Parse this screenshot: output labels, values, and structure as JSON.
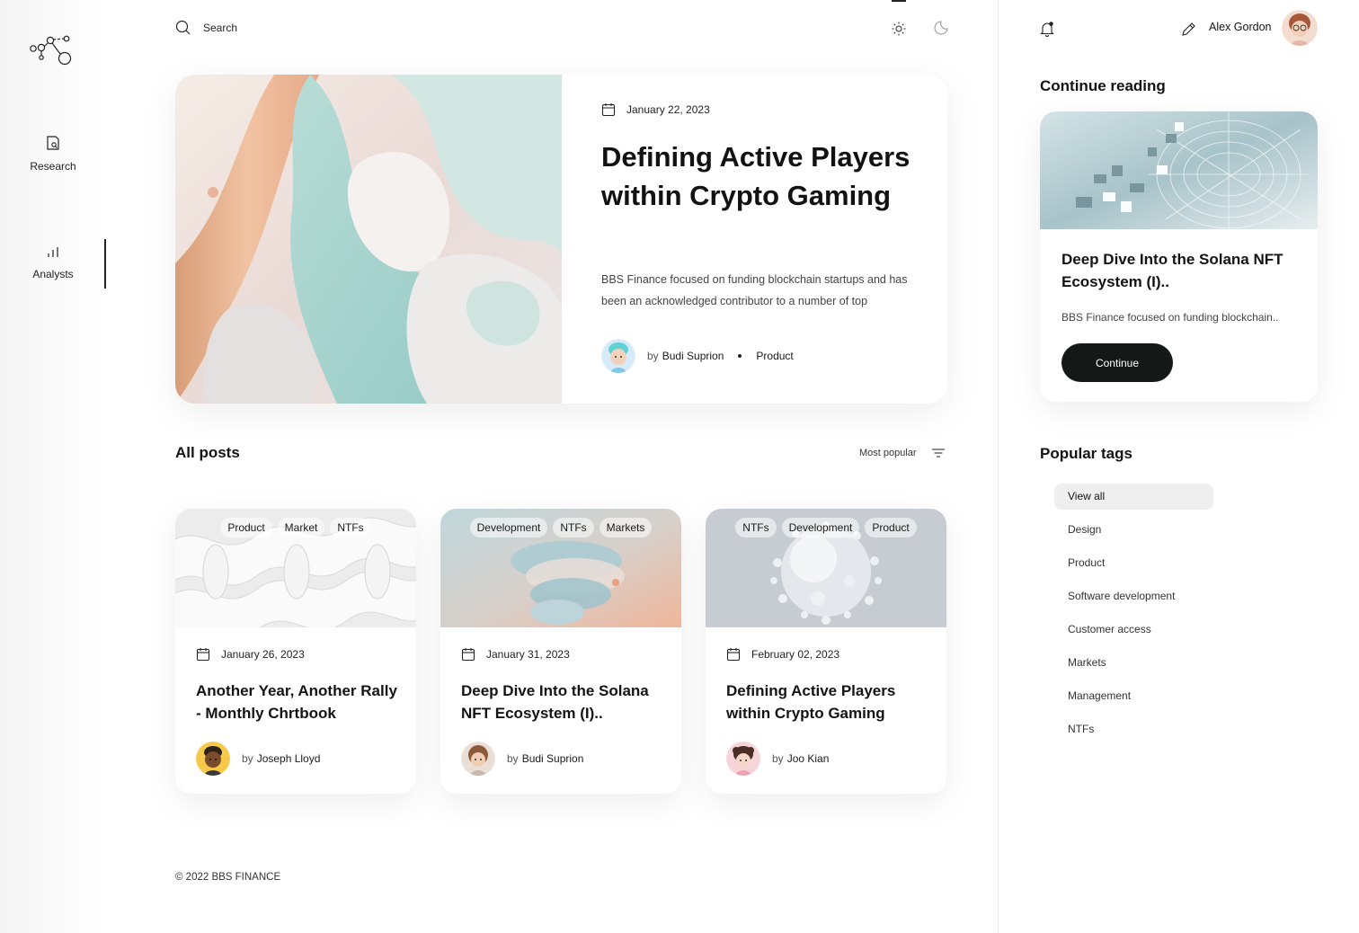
{
  "sidebar": {
    "items": [
      {
        "label": "Research",
        "icon": "search-document-icon"
      },
      {
        "label": "Analysts",
        "icon": "bar-chart-icon"
      }
    ],
    "active": "Analysts"
  },
  "header": {
    "search_placeholder": "Search"
  },
  "hero": {
    "date": "January 22, 2023",
    "title": "Defining Active Players within Crypto Gaming",
    "description": "BBS Finance focused on funding blockchain startups and has been an acknowledged contributor to a number of top",
    "author_prefix": "by",
    "author": "Budi Suprion",
    "category": "Product"
  },
  "posts": {
    "title": "All posts",
    "sort_label": "Most popular",
    "items": [
      {
        "tags": [
          "Product",
          "Market",
          "NTFs"
        ],
        "date": "January 26, 2023",
        "title": "Another Year, Another Rally - Monthly Chrtbook",
        "author_prefix": "by",
        "author": "Joseph Lloyd"
      },
      {
        "tags": [
          "Development",
          "NTFs",
          "Markets"
        ],
        "date": "January 31, 2023",
        "title": "Deep Dive Into the Solana NFT Ecosystem (I)..",
        "author_prefix": "by",
        "author": "Budi Suprion"
      },
      {
        "tags": [
          "NTFs",
          "Development",
          "Product"
        ],
        "date": "February 02, 2023",
        "title": "Defining Active Players within Crypto Gaming",
        "author_prefix": "by",
        "author": "Joo Kian"
      }
    ]
  },
  "footer": {
    "copyright": "© 2022 BBS FINANCE"
  },
  "user": {
    "name": "Alex Gordon"
  },
  "continue_reading": {
    "title": "Continue reading",
    "card_title": "Deep Dive Into the Solana NFT Ecosystem (I)..",
    "card_desc": "BBS Finance focused on funding blockchain..",
    "button": "Continue"
  },
  "popular_tags": {
    "title": "Popular tags",
    "items": [
      "View all",
      "Design",
      "Product",
      "Software development",
      "Customer access",
      "Markets",
      "Management",
      "NTFs"
    ],
    "active": "View all"
  },
  "colors": {
    "accent": "#161817",
    "background": "#ffffff",
    "active_tag_bg": "#efefef"
  }
}
